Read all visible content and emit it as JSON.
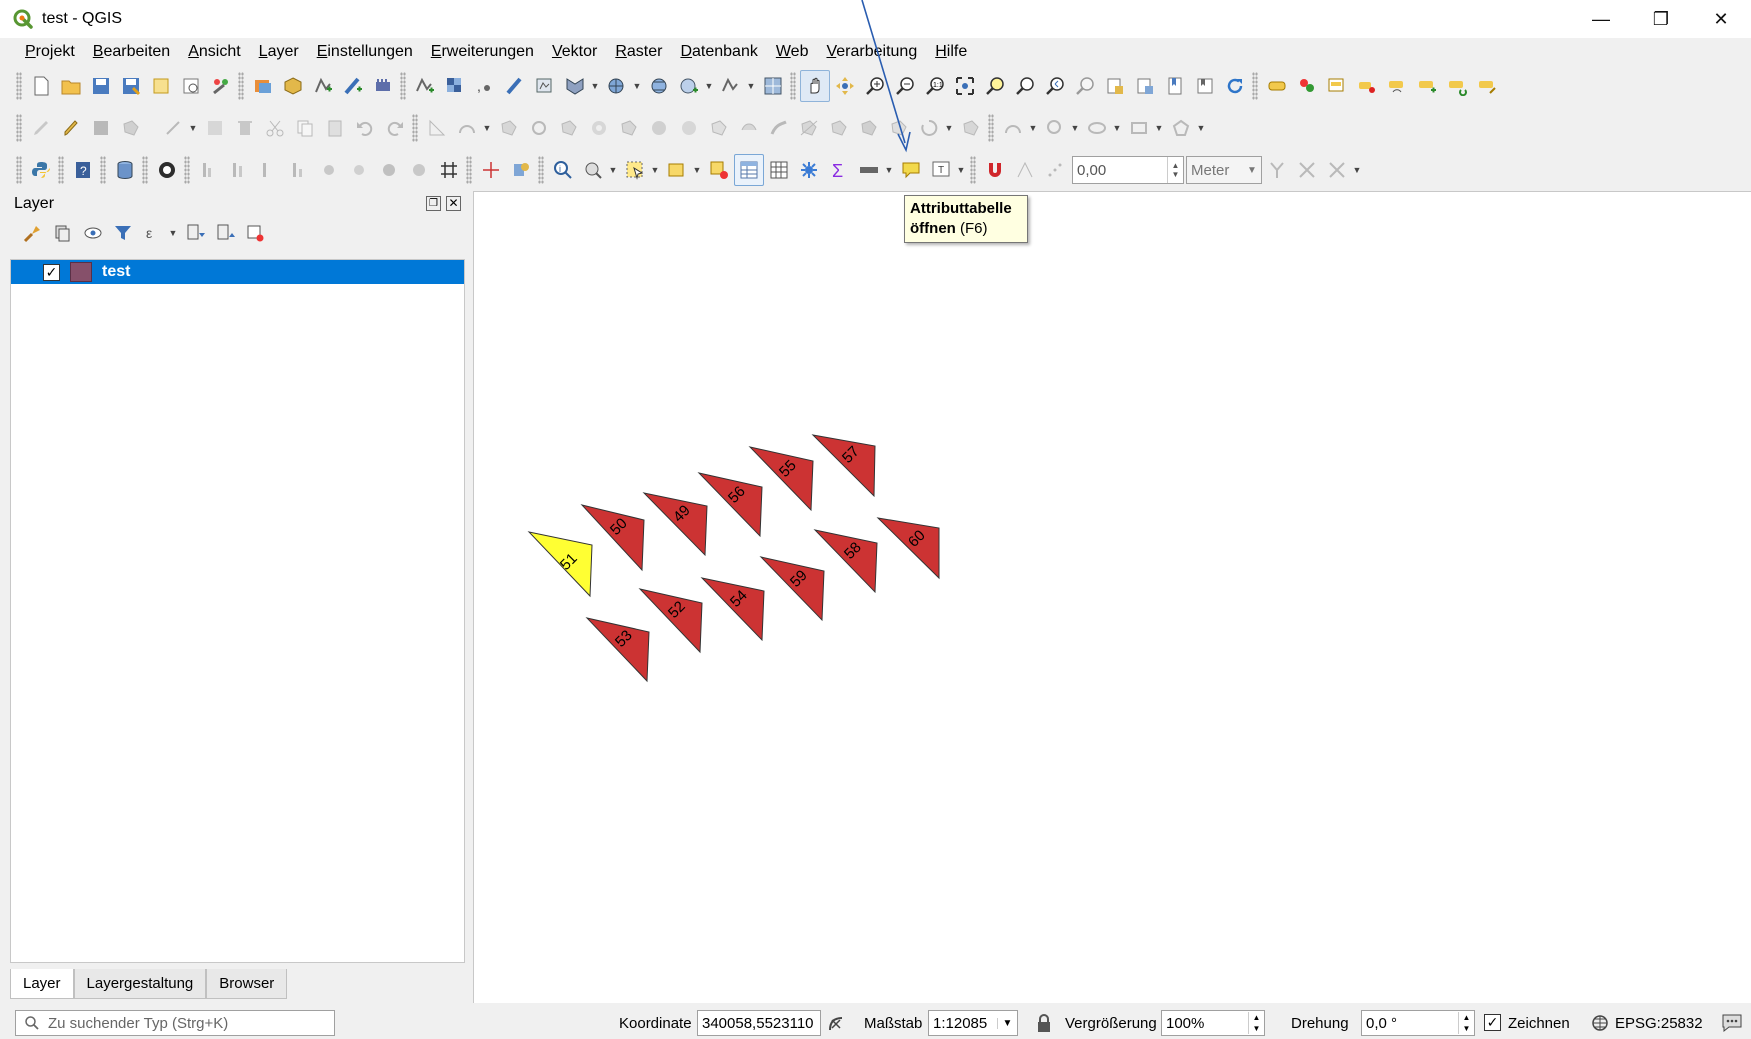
{
  "window": {
    "title": "test - QGIS",
    "controls": {
      "minimize": "—",
      "restore": "❐",
      "close": "✕"
    }
  },
  "menubar": {
    "items": [
      "Projekt",
      "Bearbeiten",
      "Ansicht",
      "Layer",
      "Einstellungen",
      "Erweiterungen",
      "Vektor",
      "Raster",
      "Datenbank",
      "Web",
      "Verarbeitung",
      "Hilfe"
    ]
  },
  "toolbars": {
    "snapping_tolerance": "0,00",
    "snapping_unit": "Meter"
  },
  "tooltip": {
    "title": "Attributtabelle öffnen",
    "title_line1": "Attributtabelle",
    "title_line2": "öffnen",
    "shortcut": "(F6)"
  },
  "layer_panel": {
    "title": "Layer",
    "layers": [
      {
        "name": "test",
        "checked": true,
        "color": "#86506a"
      }
    ]
  },
  "bottom_tabs": [
    "Layer",
    "Layergestaltung",
    "Browser"
  ],
  "map": {
    "features": [
      {
        "label": "51",
        "fill": "#ffff33",
        "selected": true
      },
      {
        "label": "50",
        "fill": "#cc3333"
      },
      {
        "label": "49",
        "fill": "#cc3333"
      },
      {
        "label": "56",
        "fill": "#cc3333"
      },
      {
        "label": "55",
        "fill": "#cc3333"
      },
      {
        "label": "57",
        "fill": "#cc3333"
      },
      {
        "label": "60",
        "fill": "#cc3333"
      },
      {
        "label": "58",
        "fill": "#cc3333"
      },
      {
        "label": "59",
        "fill": "#cc3333"
      },
      {
        "label": "54",
        "fill": "#cc3333"
      },
      {
        "label": "52",
        "fill": "#cc3333"
      },
      {
        "label": "53",
        "fill": "#cc3333"
      }
    ]
  },
  "statusbar": {
    "search_placeholder": "Zu suchender Typ (Strg+K)",
    "coordinate_label": "Koordinate",
    "coordinate_value": "340058,5523110",
    "scale_label": "Maßstab",
    "scale_value": "1:12085",
    "magnifier_label": "Vergrößerung",
    "magnifier_value": "100%",
    "rotation_label": "Drehung",
    "rotation_value": "0,0 °",
    "render_label": "Zeichnen",
    "render_checked": true,
    "crs": "EPSG:25832"
  }
}
